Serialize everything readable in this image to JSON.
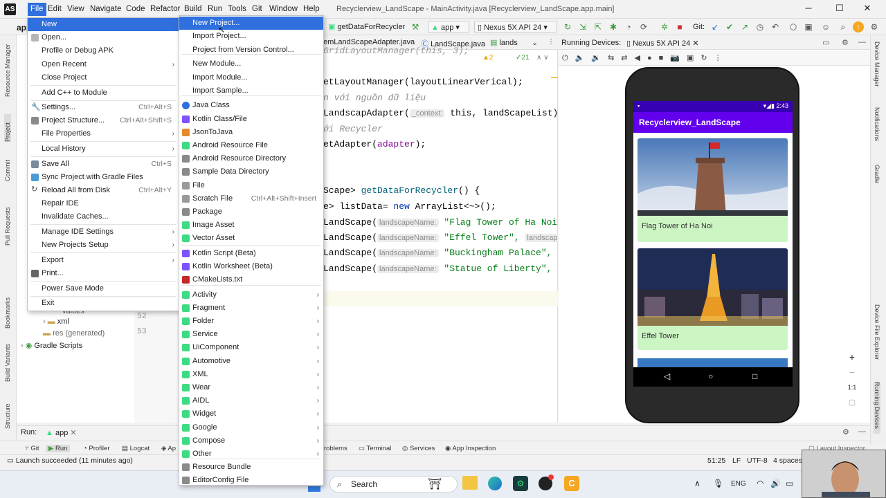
{
  "titlebar": {
    "menus": [
      "File",
      "Edit",
      "View",
      "Navigate",
      "Code",
      "Refactor",
      "Build",
      "Run",
      "Tools",
      "Git",
      "Window",
      "Help"
    ],
    "window_title": "Recyclerview_LandScape - MainActivity.java [Recyclerview_LandScape.app.main]",
    "minimize": "─",
    "maximize": "☐",
    "close": "✕"
  },
  "toolbar": {
    "run_config": "getDataForRecycler",
    "module": "app",
    "device": "Nexus 5X API 24",
    "git_label": "Git:"
  },
  "left_strip": [
    "Resource Manager",
    "Project",
    "Commit",
    "Pull Requests",
    "Bookmarks",
    "Build Variants",
    "Structure"
  ],
  "right_strip": [
    "Device Manager",
    "Notifications",
    "Gradle",
    "Device File Explorer",
    "Running Devices"
  ],
  "project_panel": {
    "header": "app",
    "items": [
      "values",
      "xml",
      "res (generated)",
      "Gradle Scripts"
    ],
    "line_numbers": [
      "52",
      "53"
    ]
  },
  "editor": {
    "tabs": [
      "emLandScapeAdapter.java",
      "LandScape.java",
      "lands"
    ],
    "warnings": "▲2",
    "checks": "✓21",
    "lines": {
      "l0": "GridLayoutManager(this, 3);",
      "l1a": "etLayoutManager(layoutLinearVerical);",
      "l2": "n với nguồn dữ liệu",
      "l3a": "LandscapAdapter(",
      "l3hint": "_context:",
      "l3b": " this, landScapeList);",
      "l4": "ới Recycler",
      "l5a": "etAdapter(",
      "l5b": "adapter",
      "l5c": ");",
      "l6a": "Scape> ",
      "l6b": "getDataForRecycler",
      "l6c": "() {",
      "l7a": "e> listData= ",
      "l7b": "new",
      "l7c": " ArrayList<~>();",
      "hint_name": "landscapeName:",
      "hint_cut": "landscap",
      "s1": "\"Flag Tower of Ha Noi",
      "s2": "\"Effel Tower\",",
      "s3": "\"Buckingham Palace\",",
      "s4": "\"Statue of Liberty\",",
      "ctor": "LandScape("
    }
  },
  "devices": {
    "label": "Running Devices:",
    "device_tab": "Nexus 5X API 24",
    "phone": {
      "time": "2:43",
      "app_title": "Recyclerview_LandScape",
      "cards": [
        "Flag Tower of Ha Noi",
        "Effel Tower"
      ]
    },
    "zoom_plus": "+",
    "zoom_minus": "−",
    "zoom_ratio": "1:1"
  },
  "run_bar": {
    "label": "Run:",
    "config": "app"
  },
  "bottom_tabs": [
    "Git",
    "Run",
    "Profiler",
    "Logcat",
    "Ap",
    "roblems",
    "Terminal",
    "Services",
    "App Inspection",
    "Layout Inspector"
  ],
  "status": {
    "message": "Launch succeeded (11 minutes ago)",
    "position": "51:25",
    "line_sep": "LF",
    "encoding": "UTF-8",
    "indent": "4 spaces"
  },
  "taskbar": {
    "search": "Search",
    "lang": "ENG"
  },
  "file_menu": {
    "items": [
      {
        "label": "New",
        "submenu": true,
        "highlight": true
      },
      {
        "label": "Open..."
      },
      {
        "label": "Profile or Debug APK"
      },
      {
        "label": "Open Recent",
        "submenu": true
      },
      {
        "label": "Close Project"
      },
      {
        "label": "Add C++ to Module"
      },
      {
        "label": "Settings...",
        "shortcut": "Ctrl+Alt+S"
      },
      {
        "label": "Project Structure...",
        "shortcut": "Ctrl+Alt+Shift+S"
      },
      {
        "label": "File Properties",
        "submenu": true
      },
      {
        "label": "Local History",
        "submenu": true
      },
      {
        "label": "Save All",
        "shortcut": "Ctrl+S"
      },
      {
        "label": "Sync Project with Gradle Files"
      },
      {
        "label": "Reload All from Disk",
        "shortcut": "Ctrl+Alt+Y"
      },
      {
        "label": "Repair IDE"
      },
      {
        "label": "Invalidate Caches..."
      },
      {
        "label": "Manage IDE Settings",
        "submenu": true
      },
      {
        "label": "New Projects Setup",
        "submenu": true
      },
      {
        "label": "Export",
        "submenu": true
      },
      {
        "label": "Print..."
      },
      {
        "label": "Power Save Mode"
      },
      {
        "label": "Exit"
      }
    ]
  },
  "new_menu": {
    "items": [
      {
        "label": "New Project...",
        "highlight": true
      },
      {
        "label": "Import Project..."
      },
      {
        "label": "Project from Version Control..."
      },
      {
        "label": "New Module..."
      },
      {
        "label": "Import Module..."
      },
      {
        "label": "Import Sample..."
      },
      {
        "label": "Java Class"
      },
      {
        "label": "Kotlin Class/File"
      },
      {
        "label": "JsonToJava"
      },
      {
        "label": "Android Resource File"
      },
      {
        "label": "Android Resource Directory"
      },
      {
        "label": "Sample Data Directory"
      },
      {
        "label": "File"
      },
      {
        "label": "Scratch File",
        "shortcut": "Ctrl+Alt+Shift+Insert"
      },
      {
        "label": "Package"
      },
      {
        "label": "Image Asset"
      },
      {
        "label": "Vector Asset"
      },
      {
        "label": "Kotlin Script (Beta)"
      },
      {
        "label": "Kotlin Worksheet (Beta)"
      },
      {
        "label": "CMakeLists.txt"
      },
      {
        "label": "Activity",
        "submenu": true
      },
      {
        "label": "Fragment",
        "submenu": true
      },
      {
        "label": "Folder",
        "submenu": true
      },
      {
        "label": "Service",
        "submenu": true
      },
      {
        "label": "UiComponent",
        "submenu": true
      },
      {
        "label": "Automotive",
        "submenu": true
      },
      {
        "label": "XML",
        "submenu": true
      },
      {
        "label": "Wear",
        "submenu": true
      },
      {
        "label": "AIDL",
        "submenu": true
      },
      {
        "label": "Widget",
        "submenu": true
      },
      {
        "label": "Google",
        "submenu": true
      },
      {
        "label": "Compose",
        "submenu": true
      },
      {
        "label": "Other",
        "submenu": true
      },
      {
        "label": "Resource Bundle"
      },
      {
        "label": "EditorConfig File"
      }
    ]
  },
  "colors": {
    "accent": "#2f6fde",
    "android_green": "#3ddc84",
    "app_purple": "#6200ee",
    "card_green": "#ccf5c4"
  }
}
